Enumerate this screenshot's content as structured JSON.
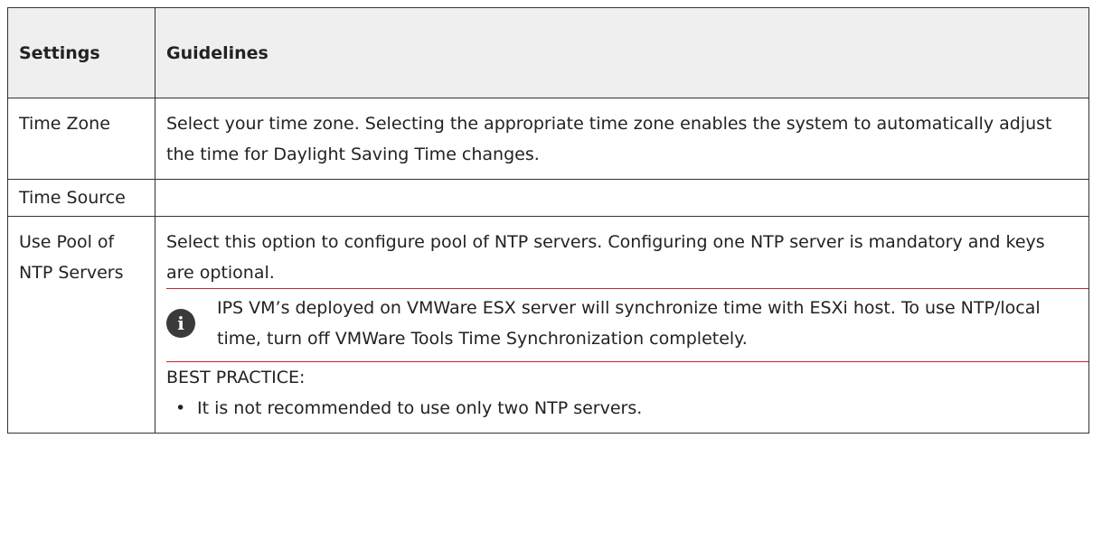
{
  "table": {
    "headers": {
      "settings": "Settings",
      "guidelines": "Guidelines"
    },
    "rows": [
      {
        "setting": "Time Zone",
        "guideline": "Select your time zone. Selecting the appropriate time zone enables the system to automatically adjust the time for Daylight Saving Time changes."
      },
      {
        "setting": "Time Source",
        "guideline": ""
      },
      {
        "setting": "Use Pool of NTP Servers",
        "guideline": "Select this option to configure pool of NTP servers. Configuring one NTP server is mandatory and keys are optional.",
        "note": {
          "icon": "info-icon",
          "text": "IPS VM’s deployed on VMWare ESX server will synchronize time with ESXi host. To use NTP/local time, turn off VMWare Tools Time Synchronization completely."
        },
        "best_practice": {
          "label": "BEST PRACTICE:",
          "items": [
            "It is not recommended to use only two NTP servers."
          ]
        }
      }
    ]
  },
  "colors": {
    "rule": "#c9242b",
    "header_bg": "#efefef",
    "border": "#333333"
  }
}
